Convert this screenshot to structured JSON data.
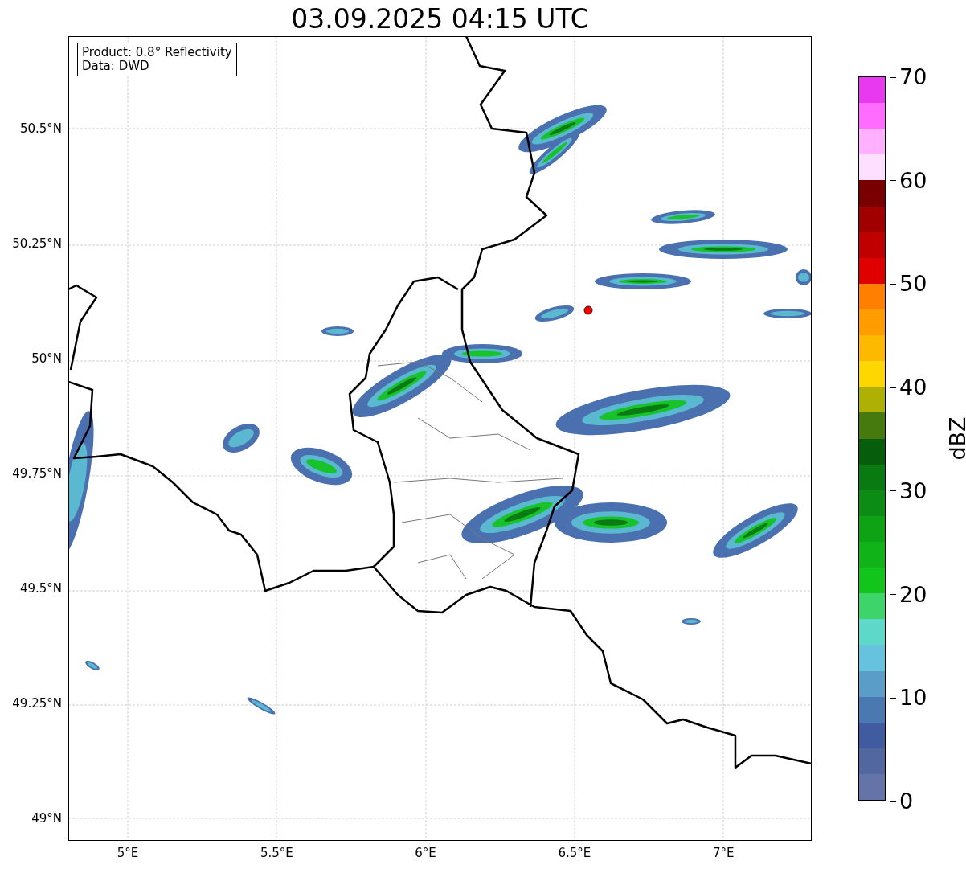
{
  "title": "03.09.2025 04:15 UTC",
  "legend": [
    "Product: 0.8° Reflectivity",
    "Data: DWD"
  ],
  "lat_ticks": [
    "50.5°N",
    "50.25°N",
    "50°N",
    "49.75°N",
    "49.5°N",
    "49.25°N",
    "49°N"
  ],
  "lon_ticks": [
    "5°E",
    "5.5°E",
    "6°E",
    "6.5°E",
    "7°E"
  ],
  "colorbar": {
    "label": "dBZ",
    "ticks": [
      "70",
      "60",
      "50",
      "40",
      "30",
      "20",
      "10",
      "0"
    ],
    "bands": [
      {
        "color": "#e838f0"
      },
      {
        "color": "#ff6cff"
      },
      {
        "color": "#ffb0ff"
      },
      {
        "color": "#ffdfff"
      },
      {
        "color": "#780000"
      },
      {
        "color": "#a00000"
      },
      {
        "color": "#c00000"
      },
      {
        "color": "#e00000"
      },
      {
        "color": "#ff7f00"
      },
      {
        "color": "#ff9c00"
      },
      {
        "color": "#ffb800"
      },
      {
        "color": "#ffd700"
      },
      {
        "color": "#aeb003"
      },
      {
        "color": "#467a0f"
      },
      {
        "color": "#065e0d"
      },
      {
        "color": "#097a11"
      },
      {
        "color": "#0c8c14"
      },
      {
        "color": "#0ea315"
      },
      {
        "color": "#10b318"
      },
      {
        "color": "#12c51a"
      },
      {
        "color": "#3dd46c"
      },
      {
        "color": "#5ed8c8"
      },
      {
        "color": "#66c2de"
      },
      {
        "color": "#5a9dc8"
      },
      {
        "color": "#4a78b0"
      },
      {
        "color": "#415ba0"
      },
      {
        "color": "#52679f"
      },
      {
        "color": "#6473a8"
      }
    ]
  }
}
